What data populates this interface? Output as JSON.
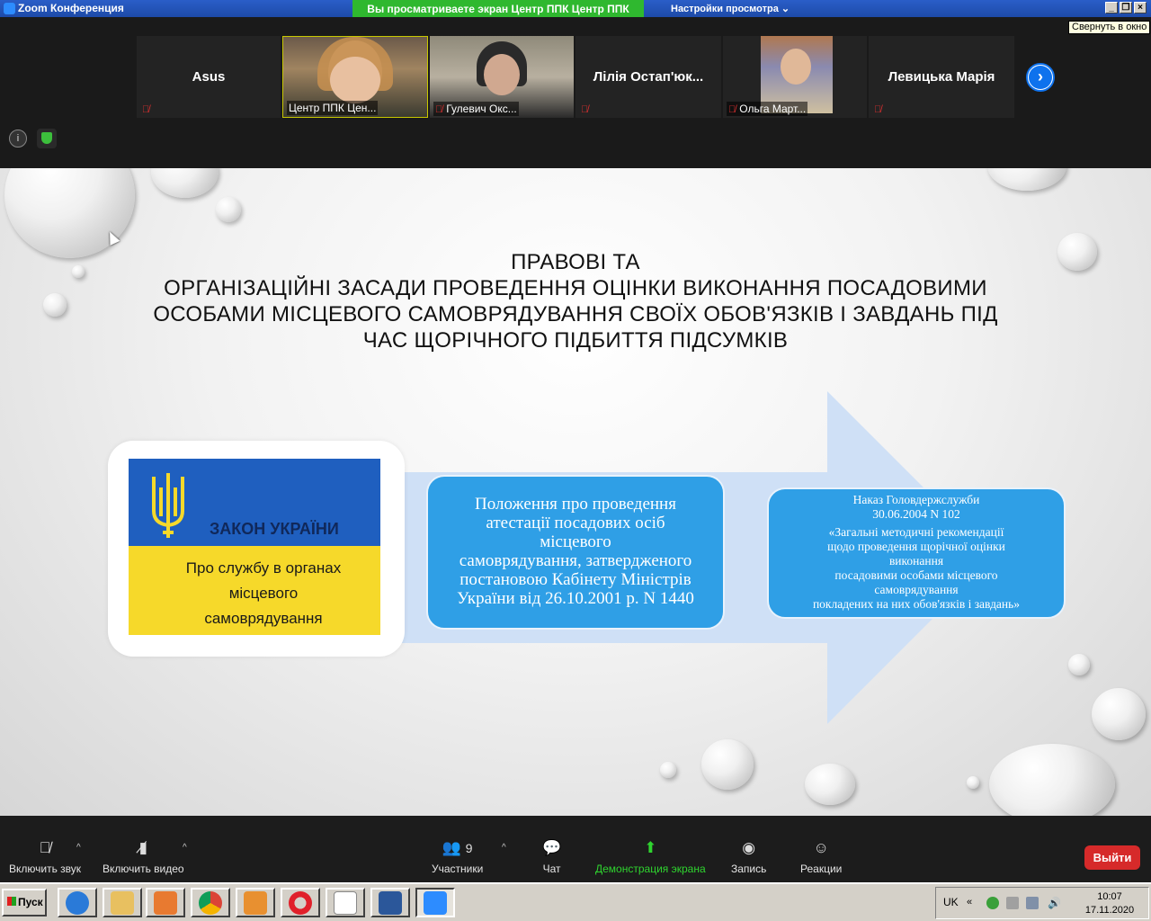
{
  "window": {
    "title": "Zoom Конференция",
    "share_banner": "Вы просматриваете экран Центр ППК Центр ППК",
    "view_settings": "Настройки просмотра",
    "tooltip": "Свернуть в окно"
  },
  "participants": [
    {
      "name": "Asus",
      "muted": true
    },
    {
      "name": "Центр ППК Цен...",
      "muted": false
    },
    {
      "name": "Гулевич Окс...",
      "muted": true
    },
    {
      "name": "Лілія  Остап'юк...",
      "muted": true
    },
    {
      "name": "Ольга Март...",
      "muted": true
    },
    {
      "name": "Левицька Марія",
      "muted": true
    }
  ],
  "icons": {
    "next": "chevron-right-icon",
    "info": "info-icon",
    "security": "shield-icon"
  },
  "slide": {
    "title_line1": "ПРАВОВІ ТА",
    "title_line2": "ОРГАНІЗАЦІЙНІ ЗАСАДИ ПРОВЕДЕННЯ ОЦІНКИ ВИКОНАННЯ ПОСАДОВИМИ",
    "title_line3": "ОСОБАМИ МІСЦЕВОГО САМОВРЯДУВАННЯ СВОЇХ ОБОВ'ЯЗКІВ І ЗАВДАНЬ ПІД",
    "title_line4": "ЧАС ЩОРІЧНОГО ПІДБИТТЯ ПІДСУМКІВ",
    "law_heading": "ЗАКОН УКРАЇНИ",
    "law_text_1": "Про службу в органах",
    "law_text_2": "місцевого",
    "law_text_3": "самоврядування",
    "box1_line1": "Положення про проведення",
    "box1_line2": "атестації посадових осіб",
    "box1_line3": "місцевого",
    "box1_line4": "самоврядування, затвердженого",
    "box1_line5": "постановою Кабінету Міністрів",
    "box1_line6": "України від 26.10.2001 р. N 1440",
    "box2_line1": "Наказ Головдержслужби",
    "box2_line2": "30.06.2004 N 102",
    "box2_line3": "«Загальні методичні рекомендації",
    "box2_line4": "щодо проведення щорічної оцінки",
    "box2_line5": "виконання",
    "box2_line6": "посадовими особами місцевого",
    "box2_line7": "самоврядування",
    "box2_line8": "покладених на них обов'язків і завдань»",
    "colors": {
      "arrow": "#cfe0f6",
      "box": "#2f9fe6",
      "flag_blue": "#1f5fbf",
      "flag_yellow": "#f6d92a"
    }
  },
  "toolbar": {
    "unmute": "Включить звук",
    "start_video": "Включить видео",
    "participants": "Участники",
    "participants_count": "9",
    "chat": "Чат",
    "share_screen": "Демонстрация экрана",
    "record": "Запись",
    "reactions": "Реакции",
    "leave": "Выйти",
    "share_color": "#2fd42f",
    "leave_color": "#d62a2a"
  },
  "taskbar": {
    "start": "Пуск",
    "language": "UK",
    "time": "10:07",
    "date": "17.11.2020"
  }
}
